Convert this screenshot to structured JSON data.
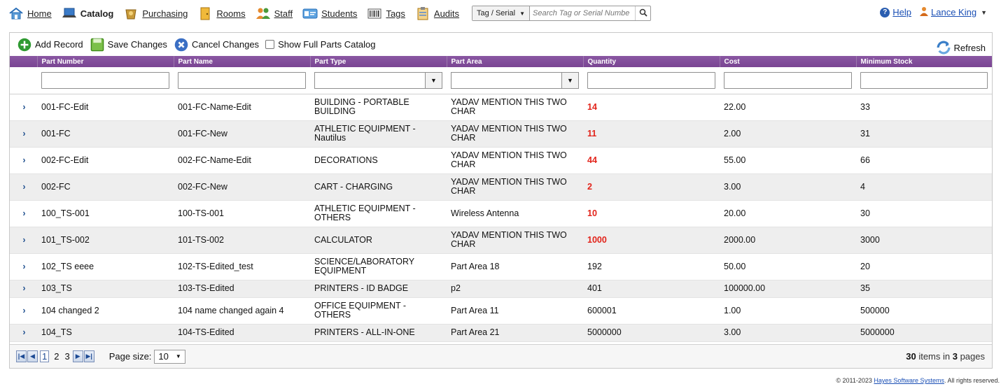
{
  "nav": {
    "items": [
      {
        "label": "Home",
        "icon": "home-icon"
      },
      {
        "label": "Catalog",
        "icon": "laptop-icon"
      },
      {
        "label": "Purchasing",
        "icon": "purchasing-icon"
      },
      {
        "label": "Rooms",
        "icon": "door-icon"
      },
      {
        "label": "Staff",
        "icon": "staff-icon"
      },
      {
        "label": "Students",
        "icon": "student-id-icon"
      },
      {
        "label": "Tags",
        "icon": "barcode-icon"
      },
      {
        "label": "Audits",
        "icon": "clipboard-icon"
      }
    ],
    "search_type": "Tag / Serial",
    "search_placeholder": "Search Tag or Serial Numbe",
    "help_label": "Help",
    "user_name": "Lance King"
  },
  "toolbar": {
    "add": "Add Record",
    "save": "Save Changes",
    "cancel": "Cancel Changes",
    "show_full": "Show Full Parts Catalog",
    "refresh": "Refresh"
  },
  "columns": [
    "Part Number",
    "Part Name",
    "Part Type",
    "Part Area",
    "Quantity",
    "Cost",
    "Minimum Stock"
  ],
  "rows": [
    {
      "num": "001-FC-Edit",
      "name": "001-FC-Name-Edit",
      "type": "BUILDING - PORTABLE BUILDING",
      "area": "YADAV MENTION THIS TWO CHAR",
      "qty": "14",
      "cost": "22.00",
      "min": "33"
    },
    {
      "num": "001-FC",
      "name": "001-FC-New",
      "type": "ATHLETIC EQUIPMENT - Nautilus",
      "area": "YADAV MENTION THIS TWO CHAR",
      "qty": "11",
      "cost": "2.00",
      "min": "31"
    },
    {
      "num": "002-FC-Edit",
      "name": "002-FC-Name-Edit",
      "type": "DECORATIONS",
      "area": "YADAV MENTION THIS TWO CHAR",
      "qty": "44",
      "cost": "55.00",
      "min": "66"
    },
    {
      "num": "002-FC",
      "name": "002-FC-New",
      "type": "CART - CHARGING",
      "area": "YADAV MENTION THIS TWO CHAR",
      "qty": "2",
      "cost": "3.00",
      "min": "4"
    },
    {
      "num": "100_TS-001",
      "name": "100-TS-001",
      "type": "ATHLETIC EQUIPMENT - OTHERS",
      "area": "Wireless Antenna",
      "qty": "10",
      "cost": "20.00",
      "min": "30"
    },
    {
      "num": "101_TS-002",
      "name": "101-TS-002",
      "type": "CALCULATOR",
      "area": "YADAV MENTION THIS TWO CHAR",
      "qty": "1000",
      "cost": "2000.00",
      "min": "3000"
    },
    {
      "num": "102_TS eeee",
      "name": "102-TS-Edited_test",
      "type": "SCIENCE/LABORATORY EQUIPMENT",
      "area": "Part Area 18",
      "qty": "192",
      "cost": "50.00",
      "min": "20"
    },
    {
      "num": "103_TS",
      "name": "103-TS-Edited",
      "type": "PRINTERS - ID BADGE",
      "area": "p2",
      "qty": "401",
      "cost": "100000.00",
      "min": "35"
    },
    {
      "num": "104 changed 2",
      "name": "104 name changed again 4",
      "type": "OFFICE EQUIPMENT - OTHERS",
      "area": "Part Area 11",
      "qty": "600001",
      "cost": "1.00",
      "min": "500000"
    },
    {
      "num": "104_TS",
      "name": "104-TS-Edited",
      "type": "PRINTERS - ALL-IN-ONE",
      "area": "Part Area 21",
      "qty": "5000000",
      "cost": "3.00",
      "min": "5000000"
    }
  ],
  "low_stock_color": "#e2231a",
  "header_color": "#7f4b98",
  "pager": {
    "pages": [
      "1",
      "2",
      "3"
    ],
    "current_page": "1",
    "page_size_label": "Page size:",
    "page_size": "10",
    "items_count": "30",
    "items_text": " items in ",
    "pages_count": "3",
    "pages_text": " pages"
  },
  "footer": {
    "prefix": "© 2011-2023 ",
    "company": "Hayes Software Systems",
    "suffix": ". All rights reserved."
  }
}
